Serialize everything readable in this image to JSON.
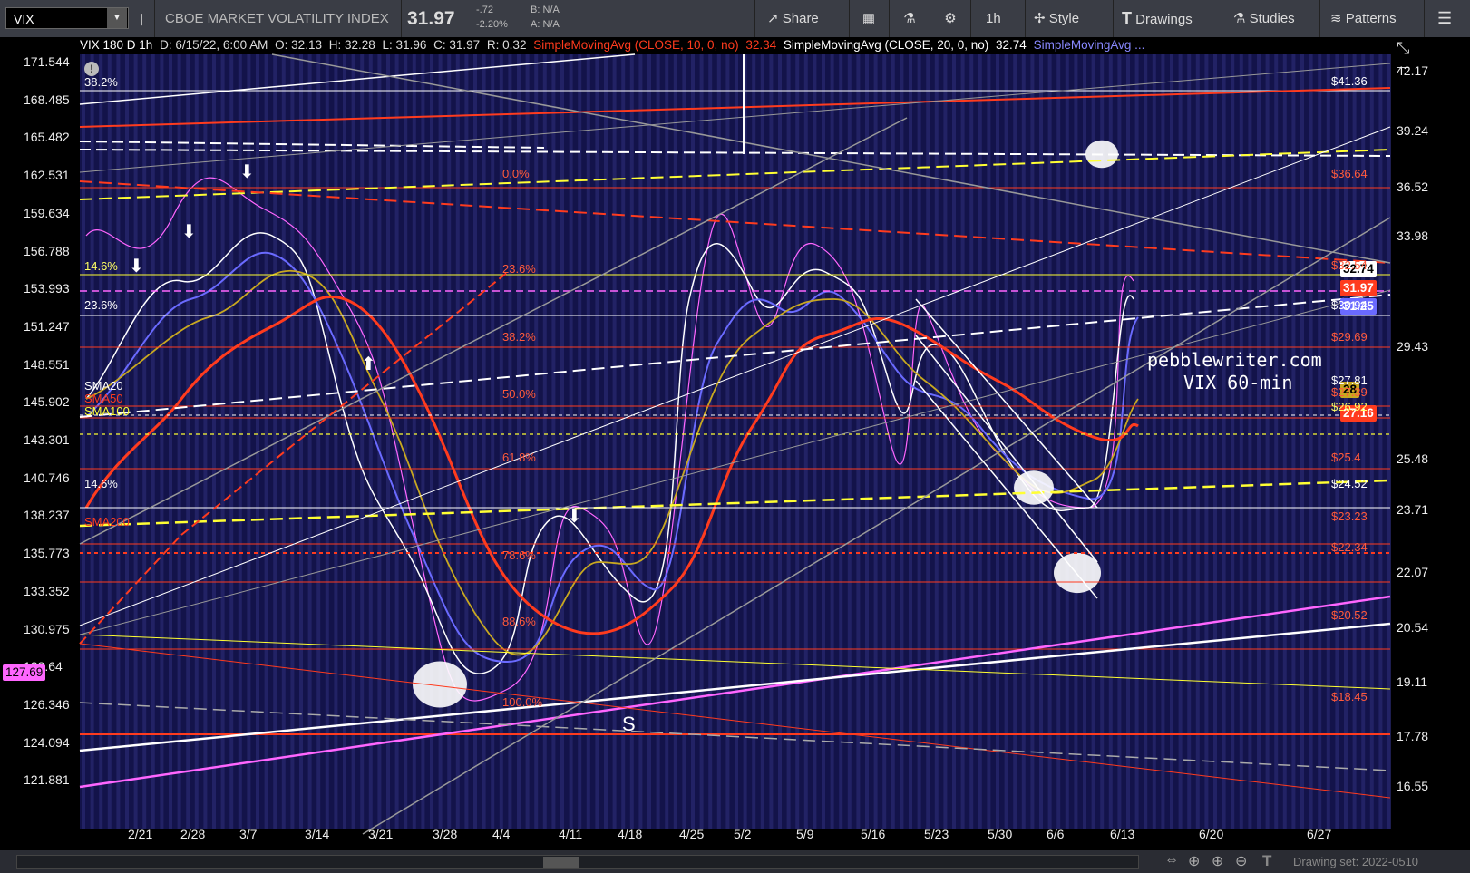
{
  "toolbar": {
    "symbol": "VIX",
    "name": "CBOE MARKET VOLATILITY INDEX",
    "last": "31.97",
    "change": "-.72",
    "change_pct": "-2.20%",
    "bid": "B: N/A",
    "ask": "A: N/A",
    "share": "Share",
    "interval": "1h",
    "style": "Style",
    "drawings": "Drawings",
    "studies": "Studies",
    "patterns": "Patterns"
  },
  "infobar": {
    "title": "VIX 180 D 1h",
    "date": "D: 6/15/22, 6:00 AM",
    "open": "O: 32.13",
    "high": "H: 32.28",
    "low": "L: 31.96",
    "close": "C: 31.97",
    "range": "R: 0.32",
    "sma10": "SimpleMovingAvg (CLOSE, 10, 0, no)",
    "sma10_val": "32.34",
    "sma20": "SimpleMovingAvg (CLOSE, 20, 0, no)",
    "sma20_val": "32.74",
    "sma_more": "SimpleMovingAvg ..."
  },
  "left_axis": [
    "171.544",
    "168.485",
    "165.482",
    "162.531",
    "159.634",
    "156.788",
    "153.993",
    "151.247",
    "148.551",
    "145.902",
    "143.301",
    "140.746",
    "138.237",
    "135.773",
    "133.352",
    "130.975",
    "128.64",
    "126.346",
    "124.094",
    "121.881"
  ],
  "left_axis_highlight": "127.69",
  "right_axis": [
    "42.17",
    "39.24",
    "36.52",
    "33.98",
    "29.43",
    "25.48",
    "23.71",
    "22.07",
    "20.54",
    "19.11",
    "17.78",
    "16.55"
  ],
  "right_tags": {
    "sma20": "32.74",
    "last": "31.97",
    "blue": "31.25",
    "yellow": "28",
    "red": "27.16"
  },
  "fib_left": {
    "f382": "38.2%",
    "f146a": "14.6%",
    "f236": "23.6%",
    "f146b": "14.6%"
  },
  "fib_mid": {
    "f0": "0.0%",
    "f236": "23.6%",
    "f382": "38.2%",
    "f50": "50.0%",
    "f618": "61.8%",
    "f786": "78.6%",
    "f886": "88.6%",
    "f100": "100.0%"
  },
  "levels_right": {
    "l4136": "$41.36",
    "l3664": "$36.64",
    "l3254": "$32.54",
    "l3094": "$30.94",
    "l2969": "$29.69",
    "l2781": "$27.81",
    "l2739": "$27.39",
    "l2692": "$26.92",
    "l254": "$25.4",
    "l2452": "$24.52",
    "l2323": "$23.23",
    "l2234": "$22.34",
    "l2052": "$20.52",
    "l1845": "$18.45"
  },
  "sma_labels": {
    "sma20": "SMA20",
    "sma50": "SMA50",
    "sma100": "SMA100",
    "sma200": "SMA200"
  },
  "watermark": {
    "site": "pebblewriter.com",
    "sub": "VIX 60-min"
  },
  "s_label": "S",
  "x_axis": [
    "2/21",
    "2/28",
    "3/7",
    "3/14",
    "3/21",
    "3/28",
    "4/4",
    "4/11",
    "4/18",
    "4/25",
    "5/2",
    "5/9",
    "5/16",
    "5/23",
    "5/30",
    "6/6",
    "6/13",
    "6/20",
    "6/27"
  ],
  "bottombar": {
    "drawing_set": "Drawing set: 2022-0510"
  },
  "colors": {
    "bg": "#000000",
    "toolbar": "#3a3d45",
    "fib": "#e8321e",
    "sma50": "#ff3b1e",
    "sma20": "#6a6aff",
    "sma10": "#ffffff",
    "sma100": "#c8a820",
    "vix": "#ff66ff",
    "trend_yellow": "#ffff33"
  }
}
